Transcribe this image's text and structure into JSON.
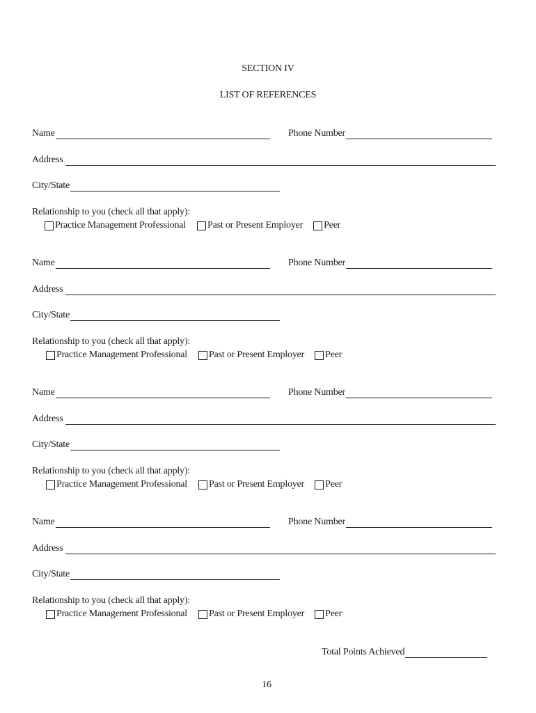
{
  "header": {
    "section": "SECTION IV",
    "title": "LIST OF REFERENCES"
  },
  "labels": {
    "name": "Name",
    "phone": "Phone Number",
    "address": "Address",
    "city_state": "City/State",
    "relationship": "Relationship to you (check all that apply):"
  },
  "options": [
    {
      "label": "Practice Management Professional",
      "checked": false
    },
    {
      "label": "Past or Present Employer",
      "checked": false
    },
    {
      "label": "Peer",
      "checked": false
    }
  ],
  "references": [
    {
      "name": "",
      "phone": "",
      "address": "",
      "city_state": ""
    },
    {
      "name": "",
      "phone": "",
      "address": "",
      "city_state": ""
    },
    {
      "name": "",
      "phone": "",
      "address": "",
      "city_state": ""
    },
    {
      "name": "",
      "phone": "",
      "address": "",
      "city_state": ""
    }
  ],
  "footer": {
    "total_points_label": "Total Points Achieved",
    "total_points_value": "",
    "page_number": "16"
  }
}
